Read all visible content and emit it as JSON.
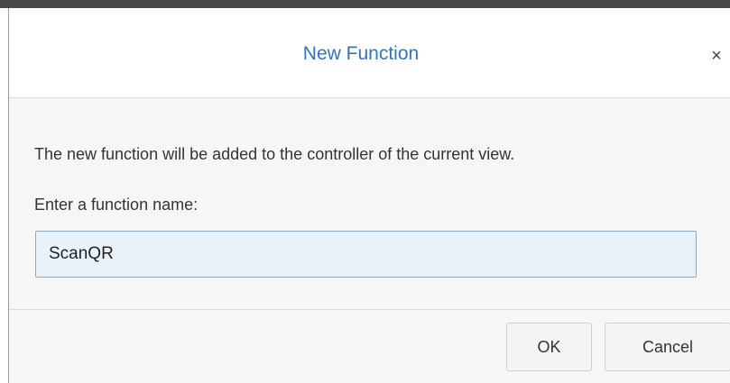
{
  "dialog": {
    "title": "New Function",
    "close_symbol": "×",
    "description": "The new function will be added to the controller of the current view.",
    "prompt_label": "Enter a function name:",
    "function_name_value": "ScanQR",
    "ok_label": "OK",
    "cancel_label": "Cancel"
  },
  "colors": {
    "title": "#2f75c4",
    "input_background": "#e8f2fb",
    "panel_background": "#f6f6f6"
  },
  "icons": {
    "close": "close-icon"
  }
}
